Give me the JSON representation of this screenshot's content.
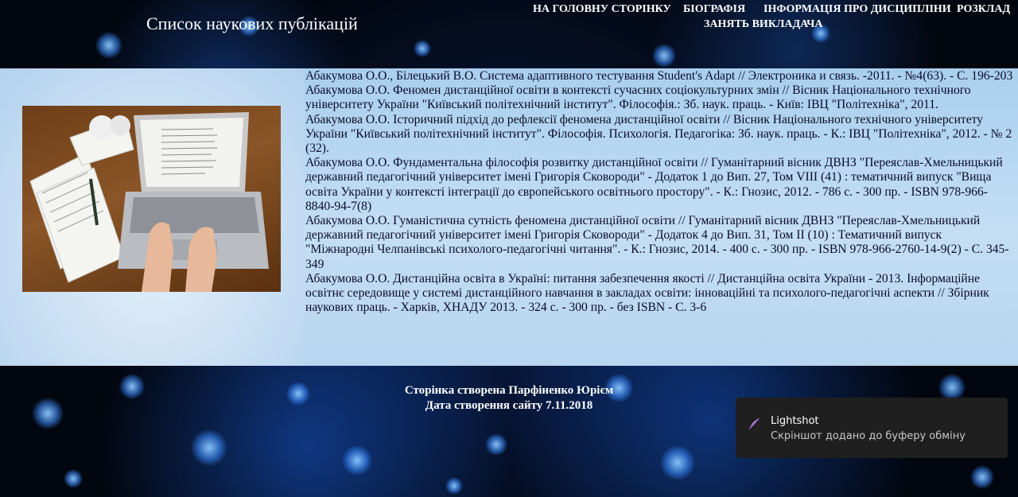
{
  "header": {
    "title": "Список наукових публікацій",
    "nav": [
      {
        "label": "НА ГОЛОВНУ СТОРІНКУ"
      },
      {
        "label": "БІОГРАФІЯ"
      },
      {
        "label": "ІНФОРМАЦІЯ ПРО ДИСЦИПЛІНИ"
      },
      {
        "label": "РОЗКЛАД"
      },
      {
        "label": "ЗАНЯТЬ ВИКЛАДАЧА"
      }
    ]
  },
  "publications": [
    {
      "text": "Абакумова О.О., Білецький В.О. Система адаптивного тестування Student's Adapt // Электроника и связь. -2011. - №4(63). - С. 196-203"
    },
    {
      "text": "Абакумова О.О. Феномен дистанційної освіти в контексті сучасних соціокультурних змін // Вісник Національного технічного університету України \"Київський політехнічний інститут\". Філософія.: Зб. наук. праць. - Київ: ІВЦ \"Політехніка\", 2011."
    },
    {
      "text": "Абакумова О.О. Історичний підхід до рефлексії феномена дистанційної освіти // Вісник Національного технічного університету України \"Київський політехнічний інститут\". Філософія. Психологія. Педагогіка: Зб. наук. праць. - К.: ІВЦ \"Політехніка\", 2012. - № 2 (32)."
    },
    {
      "text": "Абакумова О.О. Фундаментальна філософія розвитку дистанційної освіти // Гуманітарний вісник ДВНЗ \"Переяслав-Хмельницький державний педагогічний університет імені Григорія Сковороди\" - Додаток 1 до Вип. 27, Том VIII (41) : тематичний випуск \"Вища освіта України у контексті інтеграції до європейського освітнього простору\". - К.: Гнозис, 2012. - 786 с. - 300 пр. - ISBN 978-966-8840-94-7(8)"
    },
    {
      "text": "Абакумова О.О. Гуманістична сутність феномена дистанційної освіти // Гуманітарний вісник ДВНЗ \"Переяслав-Хмельницький державний педагогічний університет імені Григорія Сковороди\" - Додаток 4 до Вип. 31, Том II (10) : Тематичний випуск \"Міжнародні Челпанівські психолого-педагогічні читання\". - К.: Гнозис, 2014. - 400 с. - 300 пр. - ISBN 978-966-2760-14-9(2) - С. 345-349"
    },
    {
      "text": "Абакумова О.О. Дистанційна освіта в Україні: питання забезпечення якості // Дистанційна освіта України - 2013. Інформаційне освітнє середовище у системі дистанційного навчання в закладах освіти: інноваційні та психолого-педагогічні аспекти // Збірник наукових праць. - Харків, ХНАДУ 2013. - 324 с. - 300 пр. - без ISBN - С. 3-6"
    }
  ],
  "footer": {
    "author": "Сторінка створена Парфіненко Юрієм",
    "created": "Дата створення сайту 7.11.2018"
  },
  "toast": {
    "icon": "feather-icon",
    "title": "Lightshot",
    "message": "Скріншот додано до буферу обміну"
  },
  "colors": {
    "panel": "#b8d6ef",
    "accent": "#2f7bff"
  }
}
